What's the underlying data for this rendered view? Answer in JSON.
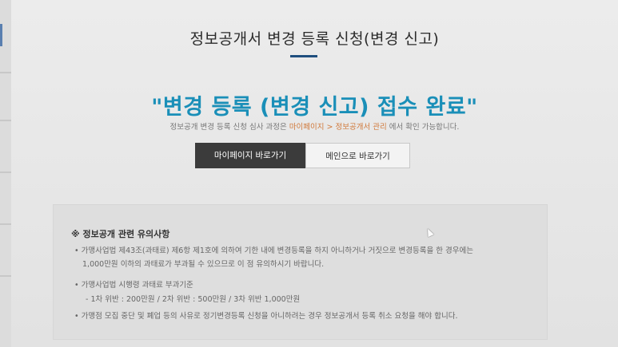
{
  "page_title": "정보공개서 변경 등록 신청(변경 신고)",
  "headline": "\"변경 등록 (변경 신고) 접수 완료\"",
  "subtext": {
    "before": "정보공개 변경 등록 신청 심사 과정은 ",
    "link": "마이페이지 > 정보공개서 관리",
    "after": " 에서 확인 가능합니다."
  },
  "buttons": {
    "mypage": "마이페이지 바로가기",
    "main": "메인으로 바로가기"
  },
  "notice": {
    "title": "※ 정보공개 관련 유의사항",
    "items": [
      "• 가맹사업법 제43조(과태료) 제6항 제1호에 의하여 기한 내에 변경등록을 하지 아니하거나 거짓으로 변경등록을 한 경우에는",
      "1,000만원 이하의 과태료가 부과될 수 있으므로 이 점 유의하시기 바랍니다.",
      "• 가맹사업법 시행령 과태료 부과기준",
      "- 1차 위반 : 200만원 / 2차 위반 : 500만원 / 3차 위반 1,000만원",
      "• 가맹점 모집 중단 및 폐업 등의 사유로 정기변경등록 신청을 아니하려는 경우 정보공개서 등록 취소 요청을 해야 합니다."
    ]
  },
  "colors": {
    "headline": "#1a8fb8",
    "title_bar": "#1f4e7e",
    "link_highlight": "#d0793b",
    "primary_button": "#3b3b3b"
  }
}
